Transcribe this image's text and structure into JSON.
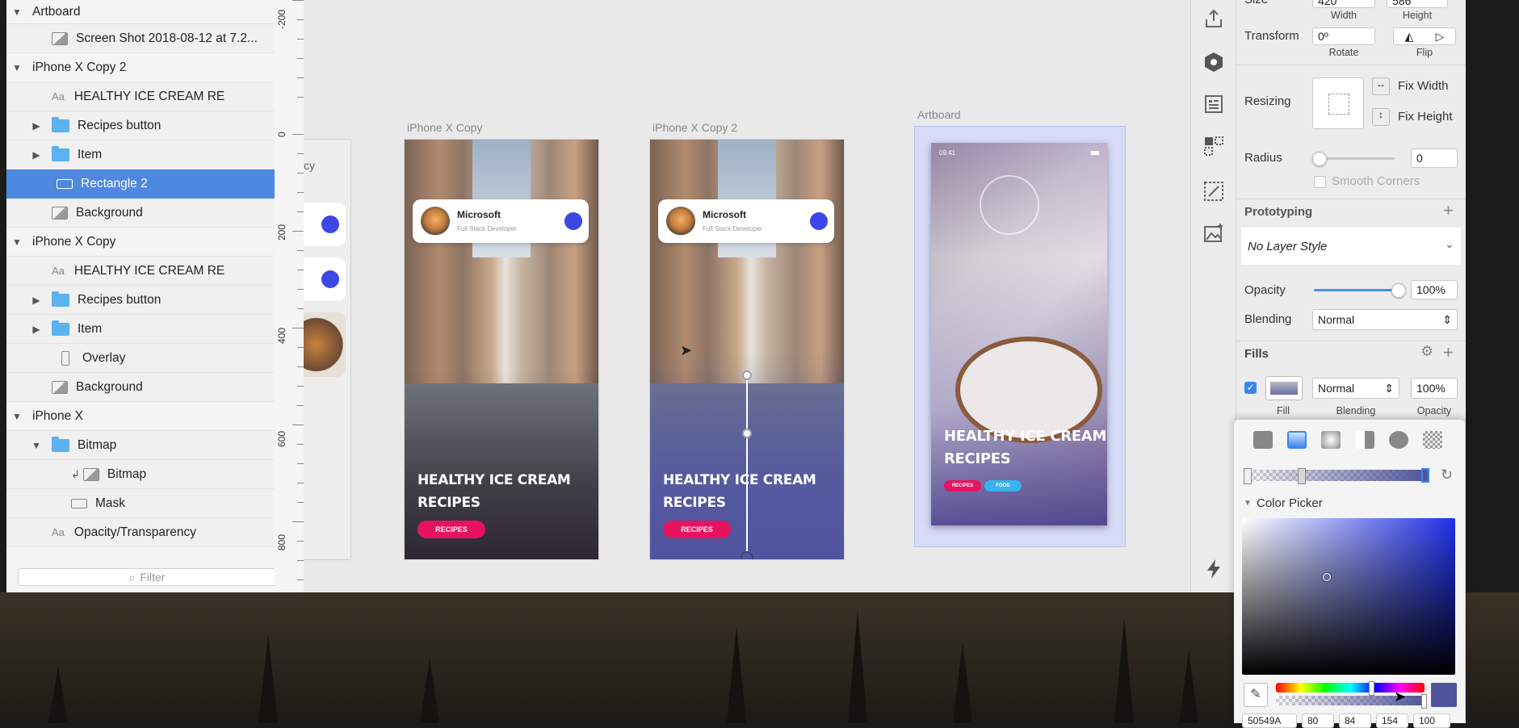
{
  "layers": {
    "rows": [
      {
        "label": "Artboard",
        "kind": "artboard",
        "expanded": true
      },
      {
        "label": "Screen Shot 2018-08-12 at 7.2...",
        "kind": "image"
      },
      {
        "label": "iPhone X Copy 2",
        "kind": "artboard",
        "expanded": true
      },
      {
        "label": "HEALTHY ICE CREAM RE",
        "kind": "text"
      },
      {
        "label": "Recipes button",
        "kind": "group"
      },
      {
        "label": "Item",
        "kind": "group"
      },
      {
        "label": "Rectangle 2",
        "kind": "shape",
        "selected": true
      },
      {
        "label": "Background",
        "kind": "image"
      },
      {
        "label": "iPhone X Copy",
        "kind": "artboard",
        "expanded": true
      },
      {
        "label": "HEALTHY ICE CREAM RE",
        "kind": "text"
      },
      {
        "label": "Recipes button",
        "kind": "group"
      },
      {
        "label": "Item",
        "kind": "group"
      },
      {
        "label": "Overlay",
        "kind": "overlay"
      },
      {
        "label": "Background",
        "kind": "image"
      },
      {
        "label": "iPhone X",
        "kind": "artboard",
        "expanded": true
      },
      {
        "label": "Bitmap",
        "kind": "group",
        "expanded": true
      },
      {
        "label": "Bitmap",
        "kind": "image"
      },
      {
        "label": "Mask",
        "kind": "shape"
      },
      {
        "label": "Opacity/Transparency",
        "kind": "text"
      }
    ],
    "filter_placeholder": "Filter"
  },
  "ruler": {
    "labels": [
      "-200",
      "0",
      "200",
      "400",
      "600",
      "800"
    ]
  },
  "canvas": {
    "partial_artboard_label": "cy",
    "artboards": [
      {
        "label": "iPhone X Copy",
        "card_name": "Microsoft",
        "card_subtitle": "Full Stack Developer",
        "headline_1": "HEALTHY ICE CREAM",
        "headline_2": "RECIPES",
        "button": "RECIPES"
      },
      {
        "label": "iPhone X Copy 2",
        "card_name": "Microsoft",
        "card_subtitle": "Full Stack Developer",
        "headline_1": "HEALTHY ICE CREAM",
        "headline_2": "RECIPES",
        "button": "RECIPES"
      },
      {
        "label": "Artboard",
        "status_time": "09:41",
        "headline_1": "HEALTHY ICE CREAM",
        "headline_2": "RECIPES",
        "tag_1": "RECIPES",
        "tag_2": "FOOD"
      }
    ]
  },
  "inspector": {
    "size_label": "Size",
    "width_value": "420",
    "height_value": "586",
    "width_label": "Width",
    "height_label": "Height",
    "transform_label": "Transform",
    "rotate_value": "0º",
    "rotate_label": "Rotate",
    "flip_label": "Flip",
    "resizing_label": "Resizing",
    "fix_width": "Fix Width",
    "fix_height": "Fix Height",
    "radius_label": "Radius",
    "radius_value": "0",
    "smooth_corners": "Smooth Corners",
    "prototyping": "Prototyping",
    "layer_style": "No Layer Style",
    "opacity_label": "Opacity",
    "opacity_value": "100%",
    "blending_label": "Blending",
    "blending_value": "Normal",
    "fills_title": "Fills",
    "fill_blend": "Normal",
    "fill_opacity": "100%",
    "fill_caption": "Fill",
    "fill_blend_caption": "Blending",
    "fill_opacity_caption": "Opacity",
    "color_picker": "Color Picker",
    "hex_value": "50549A",
    "rgb_values": [
      "80",
      "84",
      "154",
      "100"
    ]
  },
  "colors": {
    "selection": "#4f88e0",
    "accent_pink": "#e8135e",
    "accent_dot": "#3c47e6",
    "fill_color": "#50549a"
  },
  "fill_gradient_position": 0.33,
  "opacity_slider": 1.0
}
